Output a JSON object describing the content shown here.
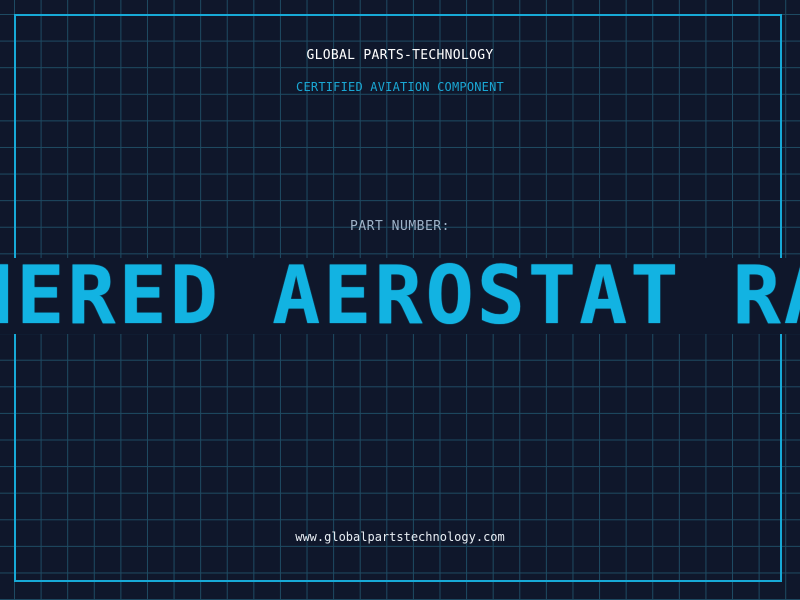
{
  "header": {
    "company": "GLOBAL PARTS-TECHNOLOGY",
    "certification": "CERTIFIED AVIATION COMPONENT"
  },
  "part": {
    "label": "PART NUMBER:",
    "number": "TETHERED AEROSTAT RADAR"
  },
  "footer": {
    "url": "www.globalpartstechnology.com"
  },
  "colors": {
    "background": "#0f172b",
    "grid": "#1e4b63",
    "accent": "#17a9d6"
  }
}
